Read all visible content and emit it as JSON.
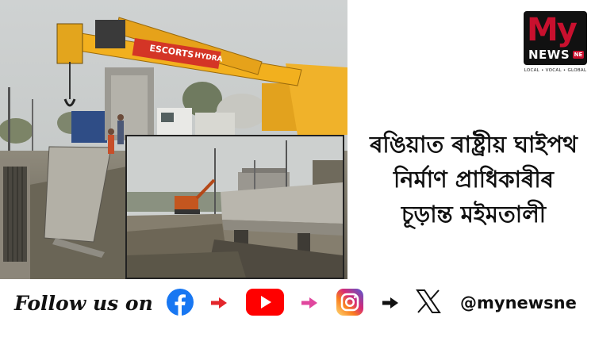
{
  "headline": {
    "line1": "ৰঙিয়াত ৰাষ্ট্ৰীয় ঘাইপথ",
    "line2": "নিৰ্মাণ প্ৰাধিকাৰীৰ",
    "line3": "চূড়ান্ত মইমতালী"
  },
  "logo": {
    "my": "My",
    "news": "NEWS",
    "ne": "NE",
    "tagline": "LOCAL • VOCAL • GLOBAL"
  },
  "photo": {
    "crane_brand": "ESCORTS",
    "crane_model": "HYDRA"
  },
  "footer": {
    "follow_text": "Follow us on",
    "handle": "@mynewsne"
  },
  "colors": {
    "brand_red": "#c8102e",
    "facebook": "#1877f2",
    "youtube": "#ff0000",
    "instagram": "#d62976",
    "arrow_red": "#e3262b",
    "arrow_pink": "#e0479e"
  },
  "icons": [
    "facebook-icon",
    "arrow-right-icon",
    "youtube-icon",
    "arrow-right-icon",
    "instagram-icon",
    "arrow-right-icon",
    "x-icon"
  ]
}
